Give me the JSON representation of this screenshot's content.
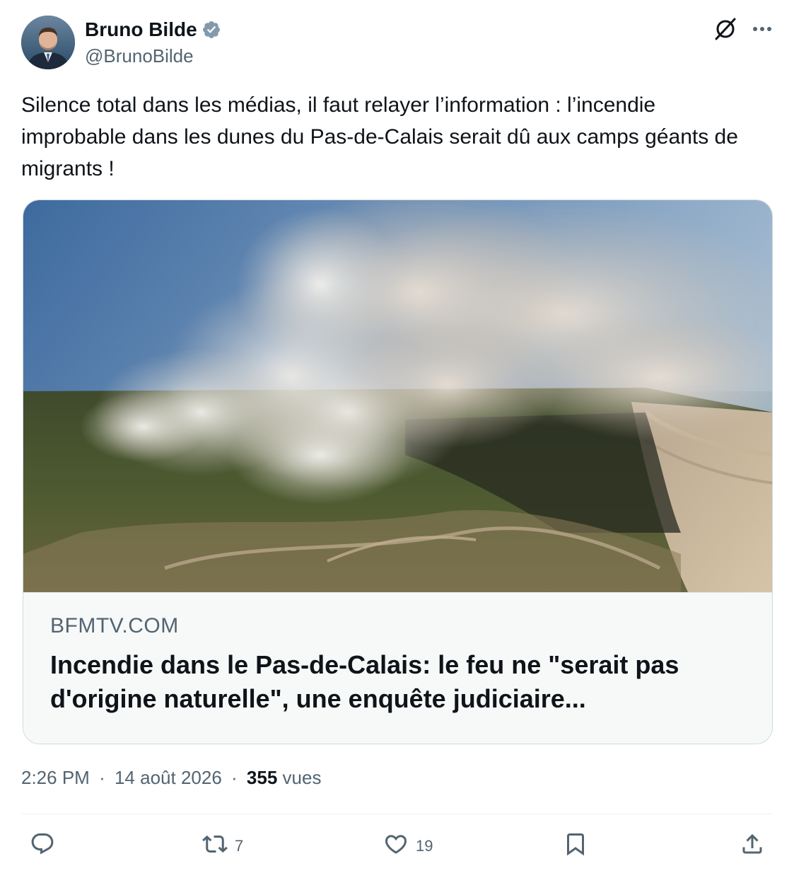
{
  "author": {
    "display_name": "Bruno Bilde",
    "handle": "@BrunoBilde",
    "avatar_icon": "avatar",
    "verified_icon": "verified-badge-icon"
  },
  "header_icons": {
    "grok": "grok-icon",
    "more": "more-icon"
  },
  "tweet": {
    "text": "Silence total dans les médias, il faut relayer l’information : l’incendie improbable dans les dunes du Pas-de-Calais serait dû aux camps géants de migrants !"
  },
  "link_card": {
    "domain": "BFMTV.COM",
    "title": "Incendie dans le Pas-de-Calais: le feu ne \"serait pas d'origine naturelle\", une enquête judiciaire..."
  },
  "meta": {
    "time": "2:26 PM",
    "separator": "·",
    "date": "14 août 2026",
    "views_count": "355",
    "views_label": "vues"
  },
  "actions": {
    "reply": {
      "icon": "reply-icon",
      "count": ""
    },
    "repost": {
      "icon": "repost-icon",
      "count": "7"
    },
    "like": {
      "icon": "like-icon",
      "count": "19"
    },
    "bookmark": {
      "icon": "bookmark-icon"
    },
    "share": {
      "icon": "share-icon"
    }
  },
  "colors": {
    "text_primary": "#0f1419",
    "text_secondary": "#536471",
    "border": "#cfd9de",
    "verified": "#829aab"
  }
}
